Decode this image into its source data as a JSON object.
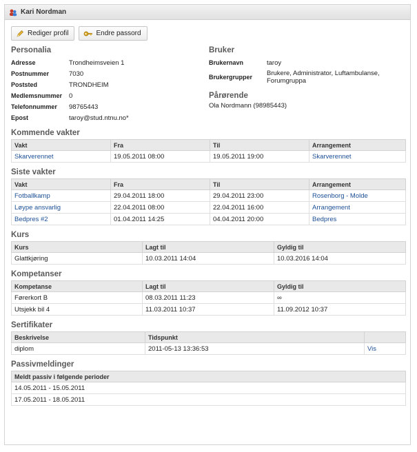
{
  "header": {
    "title": "Kari Nordman",
    "icon": "user-group-icon"
  },
  "toolbar": {
    "edit_profile": "Rediger profil",
    "change_password": "Endre passord"
  },
  "personalia": {
    "heading": "Personalia",
    "fields": [
      {
        "label": "Adresse",
        "value": "Trondheimsveien 1"
      },
      {
        "label": "Postnummer",
        "value": "7030"
      },
      {
        "label": "Poststed",
        "value": "TRONDHEIM"
      },
      {
        "label": "Medlemsnummer",
        "value": "0"
      },
      {
        "label": "Telefonnummer",
        "value": "98765443"
      },
      {
        "label": "Epost",
        "value": "taroy@stud.ntnu.no*"
      }
    ]
  },
  "bruker": {
    "heading": "Bruker",
    "username_label": "Brukernavn",
    "username": "taroy",
    "groups_label": "Brukergrupper",
    "groups": "Brukere, Administrator, Luftambulanse, Forumgruppa"
  },
  "parorende": {
    "heading": "Pårørende",
    "value": "Ola Nordmann (98985443)"
  },
  "kommende": {
    "heading": "Kommende vakter",
    "columns": [
      "Vakt",
      "Fra",
      "Til",
      "Arrangement"
    ],
    "rows": [
      [
        "Skarverennet",
        "19.05.2011 08:00",
        "19.05.2011 19:00",
        "Skarverennet"
      ]
    ]
  },
  "siste": {
    "heading": "Siste vakter",
    "columns": [
      "Vakt",
      "Fra",
      "Til",
      "Arrangement"
    ],
    "rows": [
      [
        "Fotballkamp",
        "29.04.2011 18:00",
        "29.04.2011 23:00",
        "Rosenborg - Molde"
      ],
      [
        "Løype ansvarlig",
        "22.04.2011 08:00",
        "22.04.2011 16:00",
        "Arrangement"
      ],
      [
        "Bedpres #2",
        "01.04.2011 14:25",
        "04.04.2011 20:00",
        "Bedpres"
      ]
    ]
  },
  "kurs": {
    "heading": "Kurs",
    "columns": [
      "Kurs",
      "Lagt til",
      "Gyldig til"
    ],
    "rows": [
      [
        "Glattkjøring",
        "10.03.2011 14:04",
        "10.03.2016 14:04"
      ]
    ]
  },
  "kompetanser": {
    "heading": "Kompetanser",
    "columns": [
      "Kompetanse",
      "Lagt til",
      "Gyldig til"
    ],
    "rows": [
      [
        "Førerkort B",
        "08.03.2011 11:23",
        "∞"
      ],
      [
        "Utsjekk bil 4",
        "11.03.2011 10:37",
        "11.09.2012 10:37"
      ]
    ]
  },
  "sertifikater": {
    "heading": "Sertifikater",
    "columns": [
      "Beskrivelse",
      "Tidspunkt",
      ""
    ],
    "rows": [
      [
        "diplom",
        "2011-05-13 13:36:53",
        "Vis"
      ]
    ]
  },
  "passiv": {
    "heading": "Passivmeldinger",
    "column": "Meldt passiv i følgende perioder",
    "rows": [
      "14.05.2011 - 15.05.2011",
      "17.05.2011 - 18.05.2011"
    ]
  }
}
